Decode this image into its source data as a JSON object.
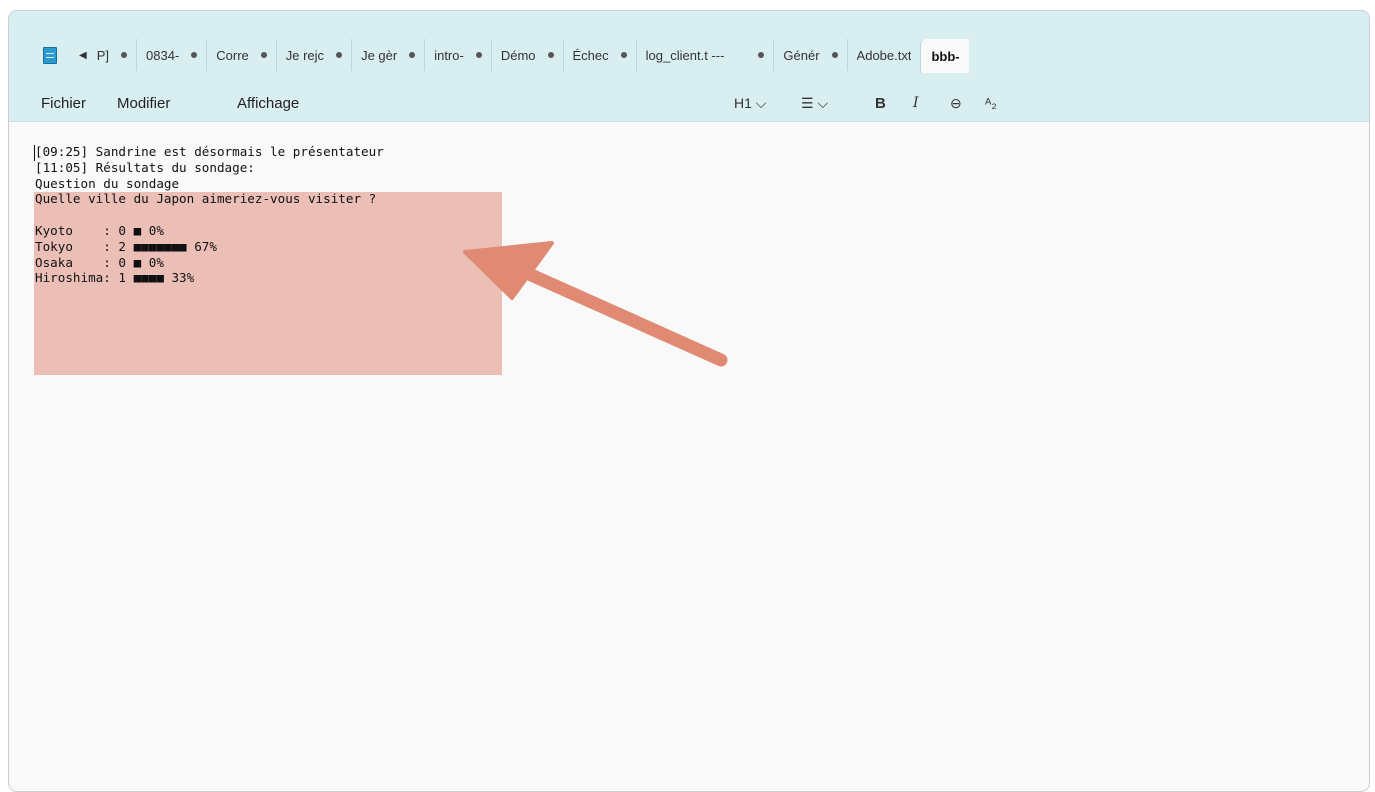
{
  "tabs": [
    {
      "label": "P]"
    },
    {
      "label": "0834-"
    },
    {
      "label": "Corre"
    },
    {
      "label": "Je rejc"
    },
    {
      "label": "Je gèr"
    },
    {
      "label": "intro-"
    },
    {
      "label": "Démo"
    },
    {
      "label": "Échec"
    },
    {
      "label": "log_client.t ---"
    },
    {
      "label": "Génér"
    },
    {
      "label": "Adobe.txt"
    },
    {
      "label": "bbb-"
    }
  ],
  "menu": {
    "file": "Fichier",
    "edit": "Modifier",
    "view": "Affichage"
  },
  "format_toolbar": {
    "heading": "H1 ⌵",
    "list": "☰ ⌵",
    "bold": "B",
    "italic": "I",
    "link": "⊖",
    "spellcheck": "ᴬ₂"
  },
  "document": {
    "lines": [
      "[09:25] Sandrine est désormais le présentateur",
      "[11:05] Résultats du sondage:",
      "Question du sondage",
      "Quelle ville du Japon aimeriez-vous visiter ?",
      "",
      "Kyoto    : 0 ■ 0%",
      "Tokyo    : 2 ■■■■■■■ 67%",
      "Osaka    : 0 ■ 0%",
      "Hiroshima: 1 ■■■■ 33%"
    ]
  },
  "colors": {
    "highlight": "#ebbfb6",
    "arrow": "#e08a74",
    "chrome": "#d9eef1"
  }
}
